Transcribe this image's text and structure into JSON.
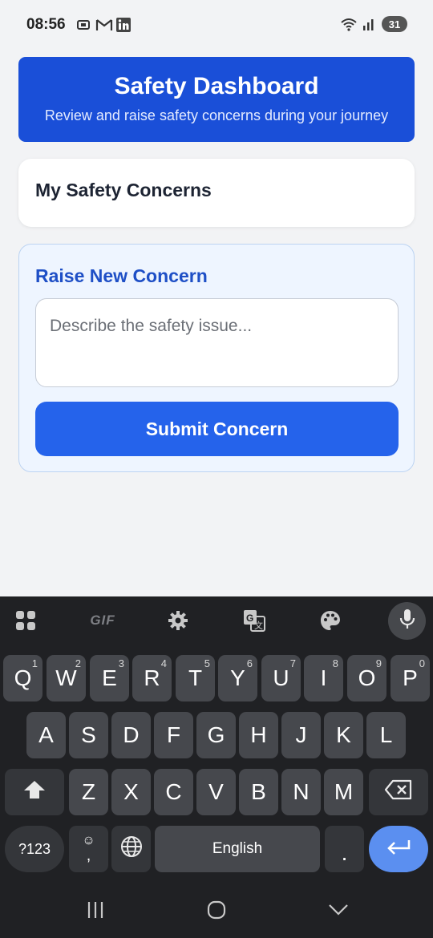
{
  "status": {
    "time": "08:56",
    "battery": "31"
  },
  "header": {
    "title": "Safety Dashboard",
    "subtitle": "Review and raise safety concerns during your journey"
  },
  "concerns": {
    "title": "My Safety Concerns"
  },
  "raise": {
    "title": "Raise New Concern",
    "placeholder": "Describe the safety issue...",
    "submit_label": "Submit Concern"
  },
  "keyboard": {
    "toolbar": {
      "gif_label": "GIF"
    },
    "row1": [
      {
        "k": "Q",
        "h": "1"
      },
      {
        "k": "W",
        "h": "2"
      },
      {
        "k": "E",
        "h": "3"
      },
      {
        "k": "R",
        "h": "4"
      },
      {
        "k": "T",
        "h": "5"
      },
      {
        "k": "Y",
        "h": "6"
      },
      {
        "k": "U",
        "h": "7"
      },
      {
        "k": "I",
        "h": "8"
      },
      {
        "k": "O",
        "h": "9"
      },
      {
        "k": "P",
        "h": "0"
      }
    ],
    "row2": [
      "A",
      "S",
      "D",
      "F",
      "G",
      "H",
      "J",
      "K",
      "L"
    ],
    "row3": [
      "Z",
      "X",
      "C",
      "V",
      "B",
      "N",
      "M"
    ],
    "symbols_label": "?123",
    "comma_label": ",",
    "space_label": "English",
    "period_label": "."
  },
  "colors": {
    "header_bg": "#1a4fd8",
    "submit_bg": "#2563eb",
    "raise_title": "#1e4fc6",
    "enter_key": "#5b8ff0"
  }
}
